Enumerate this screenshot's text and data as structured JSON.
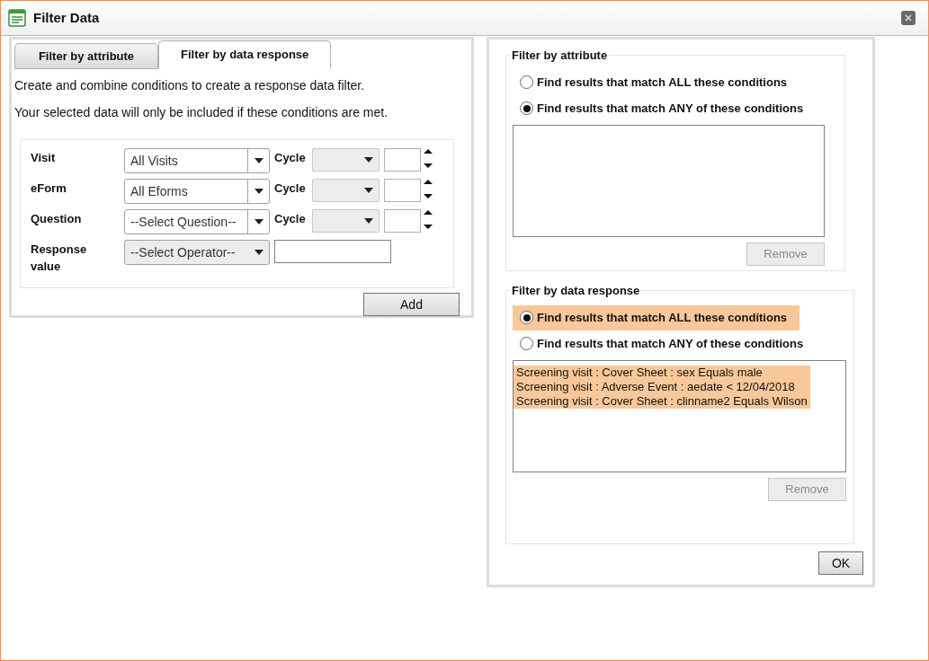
{
  "window": {
    "title": "Filter Data"
  },
  "tabs": [
    {
      "label": "Filter by attribute",
      "selected": false
    },
    {
      "label": "Filter by data response",
      "selected": true
    }
  ],
  "intro": [
    "Create and combine conditions to create a response data filter.",
    "Your selected data will only be included if these conditions are met."
  ],
  "form_rows": [
    {
      "kind": "cycle",
      "label": "Visit",
      "value": "All Visits",
      "cycle_label": "Cycle"
    },
    {
      "kind": "cycle",
      "label": "eForm",
      "value": "All Eforms",
      "cycle_label": "Cycle"
    },
    {
      "kind": "cycle",
      "label": "Question",
      "value": "--Select Question--",
      "cycle_label": "Cycle"
    },
    {
      "kind": "operator",
      "label": "Response value",
      "value": "--Select Operator--"
    }
  ],
  "add_button": "Add",
  "groups": [
    {
      "title": "Filter by attribute",
      "options": [
        {
          "label": "Find results that match ALL these conditions",
          "selected": false,
          "highlighted": false
        },
        {
          "label": "Find results that match ANY of these conditions",
          "selected": true,
          "highlighted": false
        }
      ],
      "remove_button": "Remove"
    },
    {
      "title": "Filter by data response",
      "options": [
        {
          "label": "Find results that match ALL these conditions",
          "selected": true,
          "highlighted": true
        },
        {
          "label": "Find results that match ANY of these conditions",
          "selected": false,
          "highlighted": false
        }
      ],
      "conditions": [
        {
          "text": "Screening visit : Cover Sheet : sex Equals male",
          "highlighted": true
        },
        {
          "text": "Screening visit : Adverse Event : aedate < 12/04/2018",
          "highlighted": true
        },
        {
          "text": "Screening visit : Cover Sheet : clinname2 Equals Wilson",
          "highlighted": true
        }
      ],
      "remove_button": "Remove"
    }
  ],
  "ok_button": "OK"
}
